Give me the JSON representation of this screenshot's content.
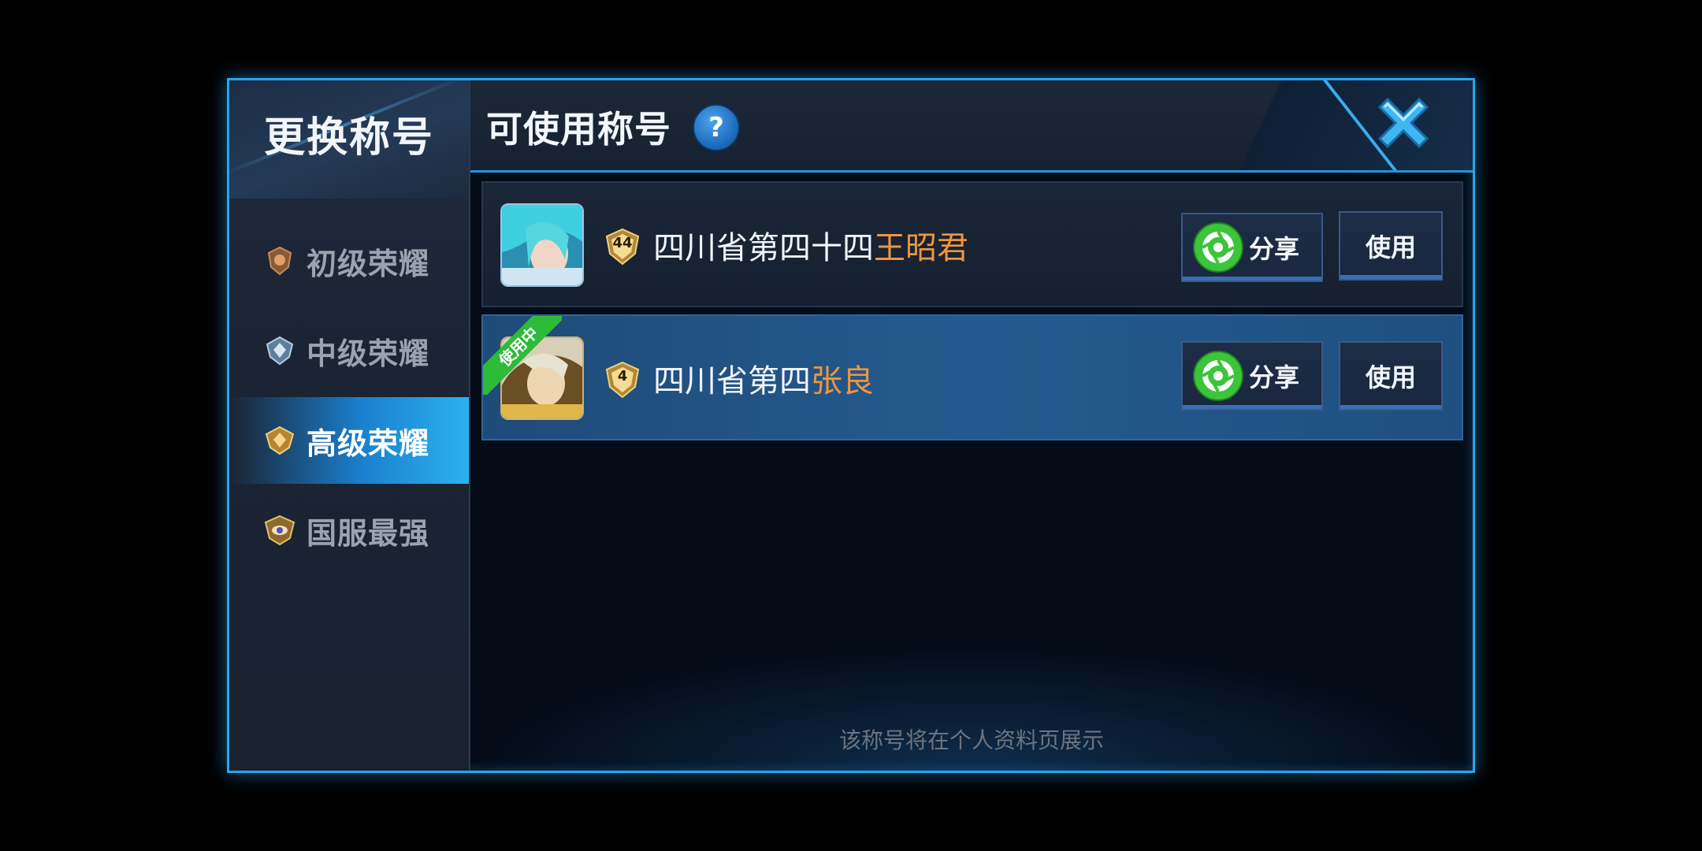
{
  "sidebar": {
    "title": "更换称号",
    "items": [
      {
        "label": "初级荣耀",
        "icon": "bronze-medal-icon",
        "active": false
      },
      {
        "label": "中级荣耀",
        "icon": "silver-medal-icon",
        "active": false
      },
      {
        "label": "高级荣耀",
        "icon": "gold-medal-icon",
        "active": true
      },
      {
        "label": "国服最强",
        "icon": "top-medal-icon",
        "active": false
      }
    ]
  },
  "header": {
    "title": "可使用称号",
    "help_label": "?",
    "close_icon": "close-x-icon"
  },
  "titles": [
    {
      "rank_number": "44",
      "prefix": "四川省第四十四",
      "hero": "王昭君",
      "share_label": "分享",
      "use_label": "使用",
      "in_use": false
    },
    {
      "rank_number": "4",
      "prefix": "四川省第四",
      "hero": "张良",
      "share_label": "分享",
      "use_label": "使用",
      "in_use": true,
      "in_use_label": "使用中"
    }
  ],
  "footer_note": "该称号将在个人资料页展示",
  "colors": {
    "accent_blue": "#2aa4ec",
    "hero_name": "#f0953d",
    "share_green": "#3cc43a",
    "in_use_green": "#2dbb3a"
  }
}
